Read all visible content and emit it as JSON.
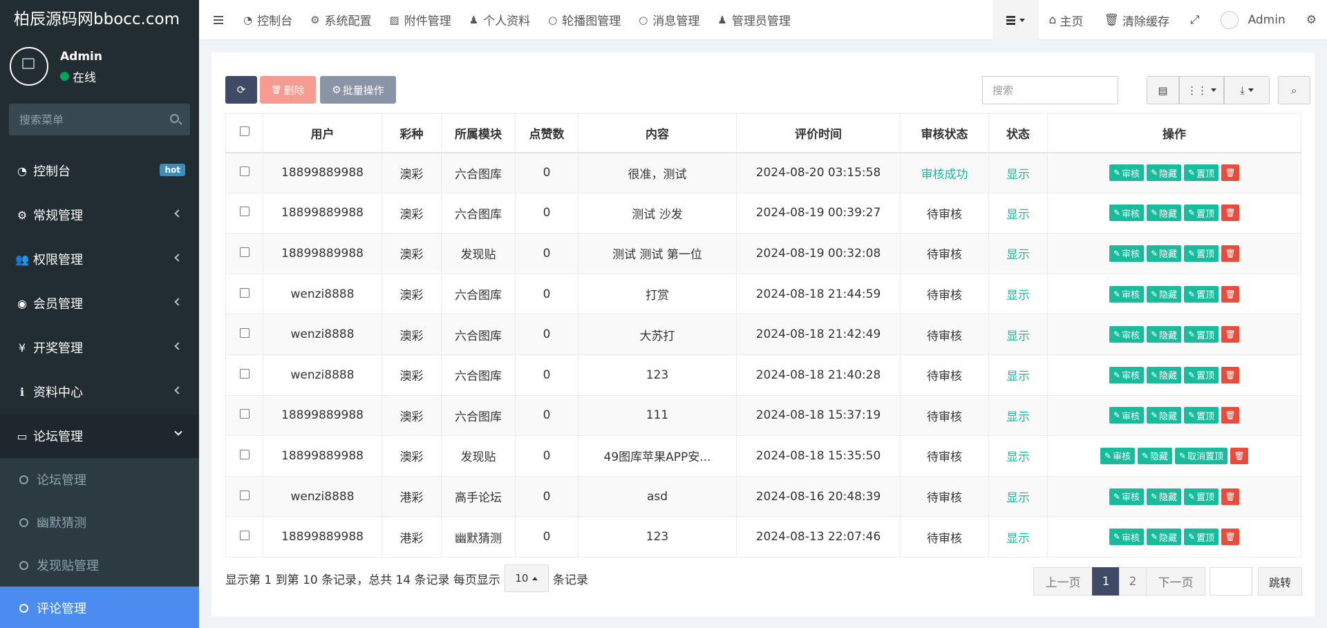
{
  "sidebar": {
    "logo": "柏辰源码网bbocc.com",
    "user": {
      "name": "Admin",
      "status": "在线"
    },
    "search_placeholder": "搜索菜单",
    "items": [
      {
        "label": "控制台",
        "icon": "dashboard-icon",
        "badge": "hot"
      },
      {
        "label": "常规管理",
        "icon": "cogs-icon"
      },
      {
        "label": "权限管理",
        "icon": "group-icon"
      },
      {
        "label": "会员管理",
        "icon": "user-circle-icon"
      },
      {
        "label": "开奖管理",
        "icon": "yen-icon"
      },
      {
        "label": "资料中心",
        "icon": "info-circle-icon"
      },
      {
        "label": "论坛管理",
        "icon": "laptop-icon",
        "expanded": true
      }
    ],
    "submenu": [
      {
        "label": "论坛管理"
      },
      {
        "label": "幽默猜测"
      },
      {
        "label": "发现贴管理"
      },
      {
        "label": "评论管理",
        "active": true
      }
    ]
  },
  "topnav": {
    "tabs": [
      {
        "label": "控制台",
        "icon": "dashboard-icon"
      },
      {
        "label": "系统配置",
        "icon": "gear-icon"
      },
      {
        "label": "附件管理",
        "icon": "image-icon"
      },
      {
        "label": "个人资料",
        "icon": "user-icon"
      },
      {
        "label": "轮播图管理",
        "icon": "circle-icon"
      },
      {
        "label": "消息管理",
        "icon": "circle-icon"
      },
      {
        "label": "管理员管理",
        "icon": "user-icon"
      }
    ],
    "right": {
      "home": "主页",
      "clear_cache": "清除缓存",
      "admin": "Admin"
    }
  },
  "toolbar": {
    "delete": "删除",
    "batch": "批量操作",
    "search_placeholder": "搜索"
  },
  "table": {
    "columns": [
      "用户",
      "彩种",
      "所属模块",
      "点赞数",
      "内容",
      "评价时间",
      "审核状态",
      "状态",
      "操作"
    ],
    "action_labels": {
      "review": "审核",
      "hide": "隐藏",
      "top": "置顶",
      "untop": "取消置顶"
    },
    "rows": [
      {
        "user": "18899889988",
        "lottery": "澳彩",
        "module": "六合图库",
        "likes": "0",
        "content": "很准，测试",
        "time": "2024-08-20 03:15:58",
        "review": "审核成功",
        "state": "显示",
        "top_label": "置顶"
      },
      {
        "user": "18899889988",
        "lottery": "澳彩",
        "module": "六合图库",
        "likes": "0",
        "content": "测试 沙发",
        "time": "2024-08-19 00:39:27",
        "review": "待审核",
        "state": "显示",
        "top_label": "置顶"
      },
      {
        "user": "18899889988",
        "lottery": "澳彩",
        "module": "发现贴",
        "likes": "0",
        "content": "测试 测试 第一位",
        "time": "2024-08-19 00:32:08",
        "review": "待审核",
        "state": "显示",
        "top_label": "置顶"
      },
      {
        "user": "wenzi8888",
        "lottery": "澳彩",
        "module": "六合图库",
        "likes": "0",
        "content": "打赏",
        "time": "2024-08-18 21:44:59",
        "review": "待审核",
        "state": "显示",
        "top_label": "置顶"
      },
      {
        "user": "wenzi8888",
        "lottery": "澳彩",
        "module": "六合图库",
        "likes": "0",
        "content": "大苏打",
        "time": "2024-08-18 21:42:49",
        "review": "待审核",
        "state": "显示",
        "top_label": "置顶"
      },
      {
        "user": "wenzi8888",
        "lottery": "澳彩",
        "module": "六合图库",
        "likes": "0",
        "content": "123",
        "time": "2024-08-18 21:40:28",
        "review": "待审核",
        "state": "显示",
        "top_label": "置顶"
      },
      {
        "user": "18899889988",
        "lottery": "澳彩",
        "module": "六合图库",
        "likes": "0",
        "content": "111",
        "time": "2024-08-18 15:37:19",
        "review": "待审核",
        "state": "显示",
        "top_label": "置顶"
      },
      {
        "user": "18899889988",
        "lottery": "澳彩",
        "module": "发现贴",
        "likes": "0",
        "content": "49图库苹果APP安...",
        "time": "2024-08-18 15:35:50",
        "review": "待审核",
        "state": "显示",
        "top_label": "取消置顶"
      },
      {
        "user": "wenzi8888",
        "lottery": "港彩",
        "module": "高手论坛",
        "likes": "0",
        "content": "asd",
        "time": "2024-08-16 20:48:39",
        "review": "待审核",
        "state": "显示",
        "top_label": "置顶"
      },
      {
        "user": "18899889988",
        "lottery": "港彩",
        "module": "幽默猜测",
        "likes": "0",
        "content": "123",
        "time": "2024-08-13 22:07:46",
        "review": "待审核",
        "state": "显示",
        "top_label": "置顶"
      }
    ]
  },
  "footer": {
    "info_prefix": "显示第 1 到第 10 条记录，总共 14 条记录 每页显示",
    "page_size": "10",
    "info_suffix": "条记录",
    "pager": {
      "prev": "上一页",
      "pages": [
        "1",
        "2"
      ],
      "next": "下一页",
      "jump": "跳转"
    }
  },
  "colors": {
    "sidebar_bg": "#222d32",
    "accent_green": "#18bc9c",
    "danger": "#e74c3c",
    "active_menu": "#4a8cf0",
    "primary_dark": "#3f4b66"
  }
}
